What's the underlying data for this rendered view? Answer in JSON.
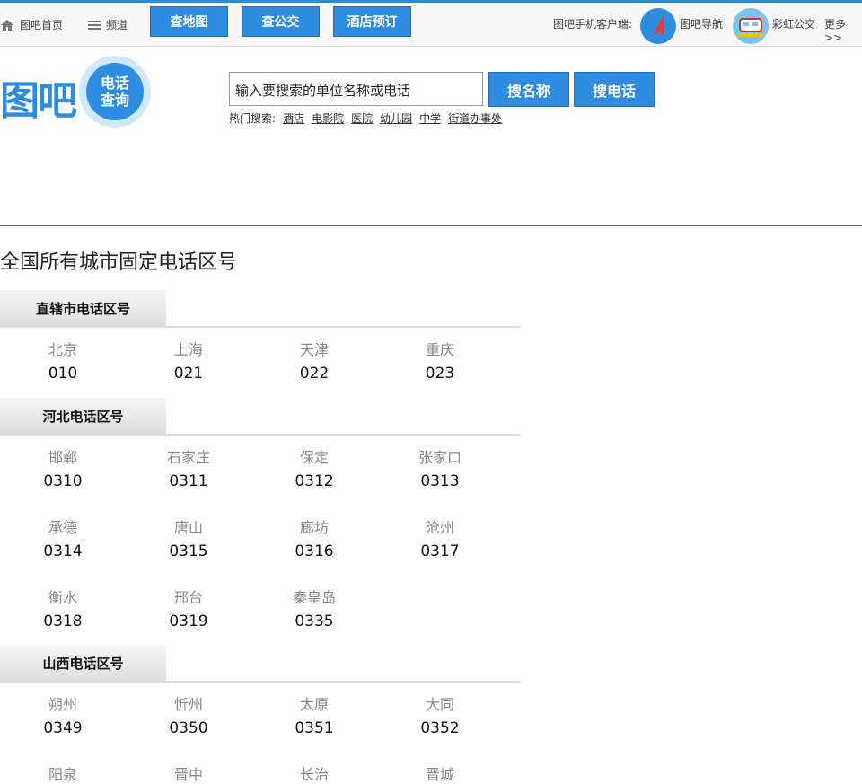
{
  "topbar": {
    "home_label": "图吧首页",
    "channel_label": "频道",
    "buttons": [
      "查地图",
      "查公交",
      "酒店预订"
    ],
    "client_label": "图吧手机客户端:",
    "nav_app": "图吧导航",
    "bus_app": "彩虹公交",
    "more": "更多>>"
  },
  "logo": {
    "brand": "图吧",
    "sub1": "电话",
    "sub2": "查询"
  },
  "search": {
    "value": "输入要搜索的单位名称或电话",
    "by_name": "搜名称",
    "by_phone": "搜电话",
    "hot_label": "热门搜索:",
    "hot_links": [
      "酒店",
      "电影院",
      "医院",
      "幼儿园",
      "中学",
      "街道办事处"
    ]
  },
  "page_title": "全国所有城市固定电话区号",
  "sections": [
    {
      "title": "直辖市电话区号",
      "cities": [
        {
          "name": "北京",
          "code": "010"
        },
        {
          "name": "上海",
          "code": "021"
        },
        {
          "name": "天津",
          "code": "022"
        },
        {
          "name": "重庆",
          "code": "023"
        }
      ]
    },
    {
      "title": "河北电话区号",
      "cities": [
        {
          "name": "邯郸",
          "code": "0310"
        },
        {
          "name": "石家庄",
          "code": "0311"
        },
        {
          "name": "保定",
          "code": "0312"
        },
        {
          "name": "张家口",
          "code": "0313"
        },
        {
          "name": "承德",
          "code": "0314"
        },
        {
          "name": "唐山",
          "code": "0315"
        },
        {
          "name": "廊坊",
          "code": "0316"
        },
        {
          "name": "沧州",
          "code": "0317"
        },
        {
          "name": "衡水",
          "code": "0318"
        },
        {
          "name": "邢台",
          "code": "0319"
        },
        {
          "name": "秦皇岛",
          "code": "0335"
        }
      ]
    },
    {
      "title": "山西电话区号",
      "cities": [
        {
          "name": "朔州",
          "code": "0349"
        },
        {
          "name": "忻州",
          "code": "0350"
        },
        {
          "name": "太原",
          "code": "0351"
        },
        {
          "name": "大同",
          "code": "0352"
        },
        {
          "name": "阳泉",
          "code": ""
        },
        {
          "name": "晋中",
          "code": ""
        },
        {
          "name": "长治",
          "code": ""
        },
        {
          "name": "晋城",
          "code": ""
        }
      ]
    }
  ],
  "colors": {
    "accent": "#2e8de0",
    "header_bg": "#f7f7f7",
    "city_text": "#888888"
  },
  "icons": [
    "home-icon",
    "menu-icon",
    "navigation-arrow-icon",
    "bus-icon"
  ]
}
